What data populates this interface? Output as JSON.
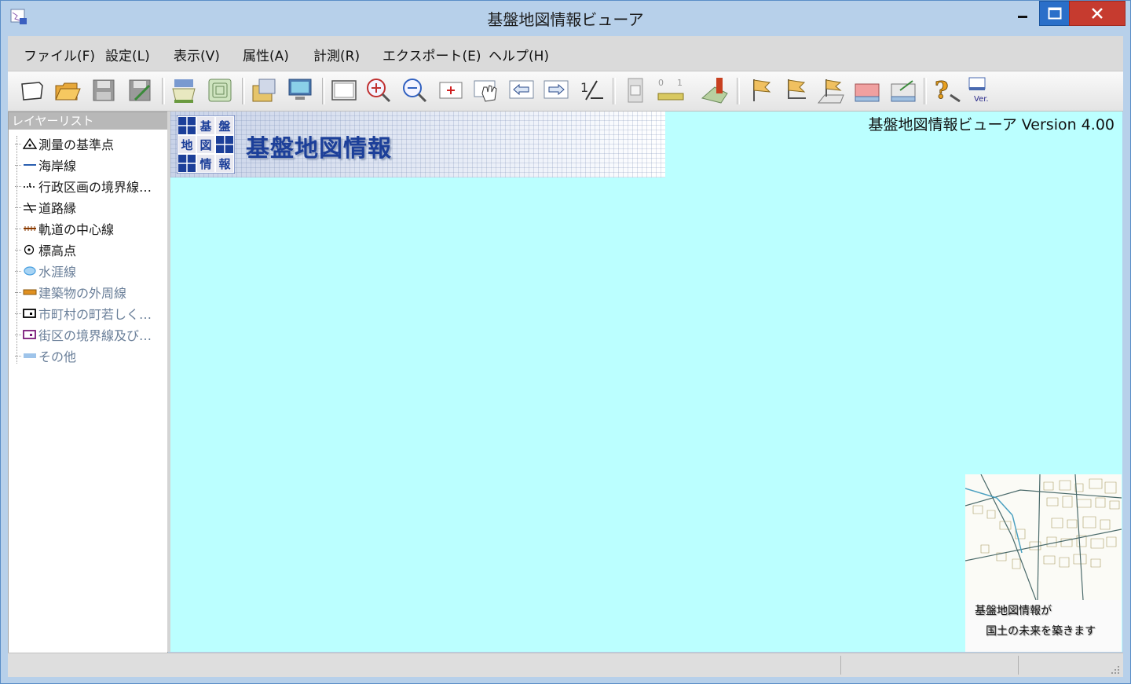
{
  "window": {
    "title": "基盤地図情報ビューア"
  },
  "menu": [
    "ファイル(F)",
    "設定(L)",
    "表示(V)",
    "属性(A)",
    "計測(R)",
    "エクスポート(E)",
    "ヘルプ(H)"
  ],
  "toolbar": [
    "new-icon",
    "open-folder-icon",
    "save-icon",
    "save-as-icon",
    "print-icon",
    "layers-icon",
    "export-image-icon",
    "display-icon",
    "full-extent-icon",
    "zoom-in-icon",
    "zoom-out-icon",
    "zoom-box-icon",
    "pan-hand-icon",
    "previous-view-icon",
    "next-view-icon",
    "scale-icon",
    "scroll-measure-icon",
    "ruler-icon",
    "area-measure-icon",
    "flag-icon",
    "flag-point-icon",
    "flag-area-icon",
    "table-icon",
    "table-export-icon",
    "help-icon",
    "version-icon"
  ],
  "layer_panel": {
    "header": "レイヤーリスト",
    "items": [
      {
        "label": "測量の基準点",
        "icon": "triangle-point-icon",
        "color": "#000000",
        "dim": false
      },
      {
        "label": "海岸線",
        "icon": "coastline-icon",
        "color": "#2a5fb0",
        "dim": false
      },
      {
        "label": "行政区画の境界線…",
        "icon": "admin-boundary-icon",
        "color": "#000000",
        "dim": false
      },
      {
        "label": "道路縁",
        "icon": "road-edge-icon",
        "color": "#000000",
        "dim": false
      },
      {
        "label": "軌道の中心線",
        "icon": "railway-icon",
        "color": "#8a3a00",
        "dim": false
      },
      {
        "label": "標高点",
        "icon": "elevation-point-icon",
        "color": "#000000",
        "dim": false
      },
      {
        "label": "水涯線",
        "icon": "water-line-icon",
        "color": "#4aa0e0",
        "dim": true
      },
      {
        "label": "建築物の外周線",
        "icon": "building-outline-icon",
        "color": "#e09020",
        "dim": true
      },
      {
        "label": "市町村の町若しく…",
        "icon": "town-boundary-icon",
        "color": "#000000",
        "dim": true
      },
      {
        "label": "街区の境界線及び…",
        "icon": "block-boundary-icon",
        "color": "#7a1a7a",
        "dim": true
      },
      {
        "label": "その他",
        "icon": "other-icon",
        "color": "#9ec4ea",
        "dim": true
      }
    ]
  },
  "map": {
    "background": "#bbffff",
    "banner_title": "基盤地図情報",
    "logo_chars": [
      "基",
      "盤",
      "地",
      "図",
      "情",
      "報"
    ],
    "version": "基盤地図情報ビューア Version 4.00",
    "minimap_line1": "基盤地図情報が",
    "minimap_line2": "国土の未来を築きます"
  }
}
